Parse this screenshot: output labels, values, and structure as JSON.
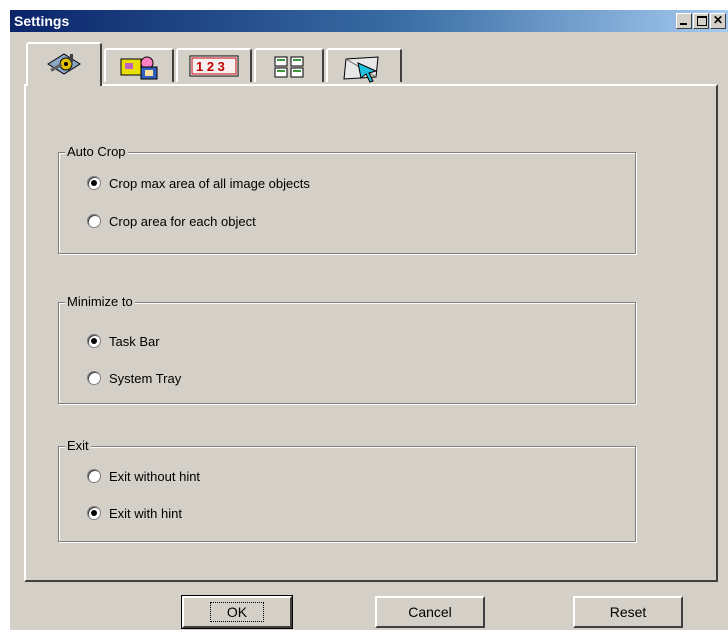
{
  "window": {
    "title": "Settings"
  },
  "tabs": [
    {
      "icon": "settings-tools-icon",
      "active": true
    },
    {
      "icon": "scan-color-icon",
      "active": false
    },
    {
      "icon": "numbering-icon",
      "active": false
    },
    {
      "icon": "layout-icon",
      "active": false
    },
    {
      "icon": "pointer-icon",
      "active": false
    }
  ],
  "groups": {
    "auto_crop": {
      "label": "Auto Crop",
      "options": [
        {
          "label": "Crop max area of all image objects",
          "selected": true
        },
        {
          "label": "Crop area for each object",
          "selected": false
        }
      ]
    },
    "minimize_to": {
      "label": "Minimize to",
      "options": [
        {
          "label": "Task Bar",
          "selected": true
        },
        {
          "label": "System Tray",
          "selected": false
        }
      ]
    },
    "exit": {
      "label": "Exit",
      "options": [
        {
          "label": "Exit without hint",
          "selected": false
        },
        {
          "label": "Exit with hint",
          "selected": true
        }
      ]
    }
  },
  "buttons": {
    "ok": "OK",
    "cancel": "Cancel",
    "reset": "Reset"
  },
  "colors": {
    "face": "#d4d0c8",
    "titlebar_start": "#0a246a",
    "titlebar_end": "#a6caf0"
  }
}
